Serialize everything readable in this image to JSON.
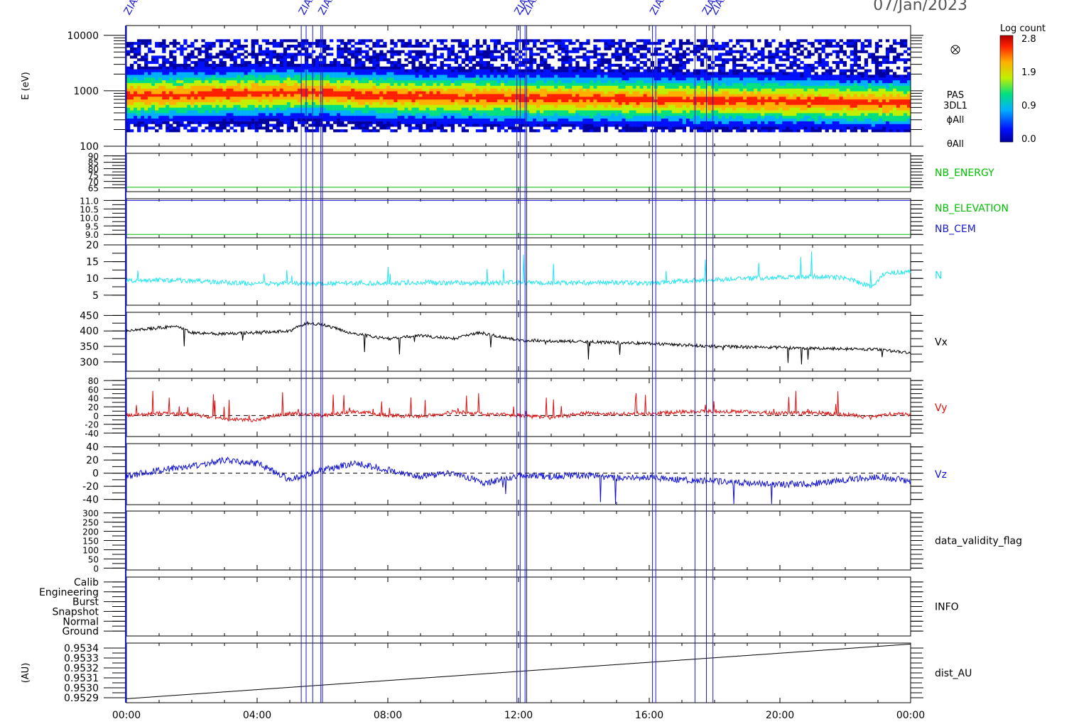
{
  "header": {
    "date": "07/Jan/2023",
    "event_label": "ZIAS"
  },
  "colors": {
    "nb_energy": "#00c000",
    "nb_cem": "#1a1acc",
    "n": "#22e6f0",
    "vx": "#000000",
    "vy": "#e01010",
    "vz": "#1010d8",
    "marker": "#1a1acc"
  },
  "colorbar": {
    "title": "Log count",
    "ticks": [
      "2.8",
      "1.9",
      "0.9",
      "0.0"
    ]
  },
  "spectrogram_labels": {
    "instrument": "PAS",
    "product": "3DL1",
    "phi": "ϕAll",
    "theta": "θAll"
  },
  "event_markers_hours": [
    5.35,
    5.5,
    5.7,
    5.95,
    6.0,
    11.95,
    12.05,
    12.2,
    12.25,
    16.1,
    16.2,
    17.4,
    17.75,
    17.95
  ],
  "x_axis": {
    "tick_labels": [
      "00:00",
      "04:00",
      "08:00",
      "12:00",
      "16:00",
      "20:00",
      "00:00"
    ],
    "range_hours": [
      0,
      24
    ]
  },
  "chart_data": [
    {
      "type": "heatmap",
      "panel": "spectrogram",
      "ylabel": "E (eV)",
      "yscale": "log",
      "ylim": [
        100,
        15000
      ],
      "tick_labels": [
        "10000",
        "1000",
        "100"
      ],
      "tick_values": [
        10000,
        1000,
        100
      ],
      "peak_energy_eV": [
        {
          "x": 0,
          "y": 800
        },
        {
          "x": 5.5,
          "y": 950
        },
        {
          "x": 8,
          "y": 800
        },
        {
          "x": 12,
          "y": 750
        },
        {
          "x": 20,
          "y": 650
        },
        {
          "x": 24,
          "y": 600
        }
      ],
      "colorbar_range": [
        0.0,
        2.8
      ]
    },
    {
      "type": "line",
      "panel": "nb_energy",
      "name": "NB_ENERGY",
      "tick_labels": [
        "90",
        "85",
        "80",
        "75",
        "70",
        "65"
      ],
      "tick_values": [
        90,
        85,
        80,
        75,
        70,
        65
      ],
      "ylim": [
        62,
        92
      ],
      "x": [
        0,
        24
      ],
      "y": [
        65.5,
        65.5
      ]
    },
    {
      "type": "line",
      "panel": "nb_elevation_cem",
      "tick_labels": [
        "11.0",
        "10.5",
        "10.0",
        "9.5",
        "9.0"
      ],
      "tick_values": [
        11.0,
        10.5,
        10.0,
        9.5,
        9.0
      ],
      "ylim": [
        8.8,
        11.1
      ],
      "series": [
        {
          "name": "NB_ELEVATION",
          "x": [
            0,
            24
          ],
          "y": [
            9.0,
            9.0
          ]
        },
        {
          "name": "NB_CEM",
          "x": [
            0,
            24
          ],
          "y": [
            11.0,
            11.0
          ]
        }
      ]
    },
    {
      "type": "line",
      "panel": "n",
      "name": "N",
      "tick_labels": [
        "20",
        "15",
        "10",
        "5"
      ],
      "tick_values": [
        20,
        15,
        10,
        5
      ],
      "ylim": [
        2,
        20
      ],
      "x": [
        0,
        1,
        2,
        3,
        4,
        5,
        6,
        7,
        8,
        9,
        10,
        11,
        12,
        13,
        14,
        15,
        16,
        17,
        18,
        19,
        20,
        21,
        22,
        22.8,
        23.2,
        24
      ],
      "y": [
        9.2,
        9.5,
        9.3,
        8.8,
        8.4,
        8.5,
        8.4,
        8.6,
        8.5,
        8.8,
        8.7,
        8.6,
        8.8,
        8.6,
        8.7,
        8.8,
        8.4,
        9.3,
        9.6,
        10.0,
        10.3,
        10.6,
        10.2,
        7.5,
        11.5,
        12.0
      ]
    },
    {
      "type": "line",
      "panel": "vx",
      "name": "Vx",
      "tick_labels": [
        "450",
        "400",
        "350",
        "300"
      ],
      "tick_values": [
        450,
        400,
        350,
        300
      ],
      "ylim": [
        270,
        460
      ],
      "x": [
        0,
        1,
        1.5,
        2,
        3,
        4,
        5,
        5.5,
        6,
        7,
        8,
        9,
        10,
        10.8,
        11.5,
        12,
        13,
        14,
        15,
        16,
        17,
        18,
        19,
        20,
        21,
        22,
        23,
        24
      ],
      "y": [
        400,
        410,
        415,
        395,
        390,
        395,
        400,
        425,
        420,
        390,
        375,
        385,
        375,
        395,
        380,
        370,
        368,
        365,
        362,
        360,
        355,
        350,
        348,
        346,
        344,
        342,
        340,
        330
      ]
    },
    {
      "type": "line",
      "panel": "vy",
      "name": "Vy",
      "tick_labels": [
        "80",
        "60",
        "40",
        "20",
        "0",
        "-20",
        "-40"
      ],
      "tick_values": [
        80,
        60,
        40,
        20,
        0,
        -20,
        -40
      ],
      "ylim": [
        -48,
        85
      ],
      "zero_line": true,
      "x": [
        0,
        1,
        2,
        3,
        4,
        5,
        6,
        7,
        8,
        9,
        10,
        11,
        12,
        13,
        14,
        15,
        16,
        17,
        18,
        19,
        20,
        21,
        22,
        22.8,
        23.2,
        24
      ],
      "y": [
        0,
        5,
        3,
        -8,
        -10,
        5,
        0,
        10,
        0,
        -2,
        8,
        3,
        0,
        -5,
        5,
        3,
        5,
        8,
        10,
        8,
        5,
        6,
        3,
        -5,
        3,
        2
      ]
    },
    {
      "type": "line",
      "panel": "vz",
      "name": "Vz",
      "tick_labels": [
        "40",
        "20",
        "0",
        "-20",
        "-40"
      ],
      "tick_values": [
        40,
        20,
        0,
        -20,
        -40
      ],
      "ylim": [
        -48,
        45
      ],
      "zero_line": true,
      "x": [
        0,
        1,
        2,
        3,
        4,
        5,
        6,
        7,
        8,
        9,
        10,
        11,
        12,
        13,
        14,
        15,
        16,
        17,
        18,
        19,
        20,
        21,
        22,
        23,
        24
      ],
      "y": [
        -5,
        5,
        10,
        20,
        15,
        -10,
        5,
        15,
        5,
        -5,
        0,
        -15,
        -3,
        -5,
        -3,
        -8,
        -6,
        -10,
        -12,
        -15,
        -17,
        -16,
        -10,
        -5,
        -12
      ]
    },
    {
      "type": "line",
      "panel": "data_validity_flag",
      "name": "data_validity_flag",
      "tick_labels": [
        "300",
        "250",
        "200",
        "150",
        "100",
        "50",
        "0"
      ],
      "tick_values": [
        300,
        250,
        200,
        150,
        100,
        50,
        0
      ],
      "ylim": [
        -10,
        310
      ]
    },
    {
      "type": "line",
      "panel": "info",
      "name": "INFO",
      "tick_labels": [
        "Calib",
        "Engineering",
        "Burst",
        "Snapshot",
        "Normal",
        "Ground"
      ],
      "tick_values": [
        5,
        4,
        3,
        2,
        1,
        0
      ],
      "ylim": [
        -0.5,
        5.5
      ]
    },
    {
      "type": "line",
      "panel": "dist_au",
      "name": "dist_AU",
      "ylabel": "(AU)",
      "tick_labels": [
        "0.9534",
        "0.9533",
        "0.9532",
        "0.9531",
        "0.9530",
        "0.9529"
      ],
      "tick_values": [
        0.9534,
        0.9533,
        0.9532,
        0.9531,
        0.953,
        0.9529
      ],
      "ylim": [
        0.95285,
        0.95345
      ],
      "x": [
        0,
        24
      ],
      "y": [
        0.95289,
        0.95344
      ]
    }
  ]
}
